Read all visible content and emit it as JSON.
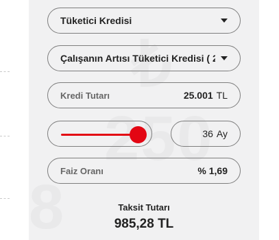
{
  "loan_type": {
    "selected": "Tüketici Kredisi"
  },
  "product": {
    "selected": "Çalışanın Artısı Tüketici Kredisi ( 2..."
  },
  "amount": {
    "label": "Kredi Tutarı",
    "value": "25.001",
    "unit": "TL"
  },
  "term": {
    "value": "36",
    "unit": "Ay",
    "slider_fraction": 1.0
  },
  "interest": {
    "label": "Faiz Oranı",
    "value": "% 1,69"
  },
  "result": {
    "label": "Taksit Tutarı",
    "value": "985,28 TL"
  },
  "colors": {
    "accent": "#e30613",
    "panel_bg": "#f1f1f2",
    "border": "#7d7d7d"
  }
}
